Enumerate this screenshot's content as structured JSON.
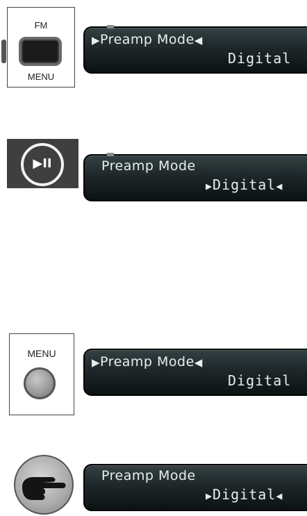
{
  "steps": [
    {
      "control": {
        "top_label": "FM",
        "bottom_label": "MENU"
      },
      "display": {
        "line1": "Preamp Mode",
        "line2": "Digital",
        "selected_line": 1
      }
    },
    {
      "control": {
        "icon": "play-pause-icon"
      },
      "display": {
        "line1": "Preamp Mode",
        "line2": "Digital",
        "selected_line": 2
      }
    },
    {
      "control": {
        "label": "MENU"
      },
      "display": {
        "line1": "Preamp Mode",
        "line2": "Digital",
        "selected_line": 1
      }
    },
    {
      "control": {
        "icon": "hand-pointer-icon"
      },
      "display": {
        "line1": "Preamp Mode",
        "line2": "Digital",
        "selected_line": 2
      }
    }
  ],
  "colors": {
    "lcd_background": "#1e2729",
    "lcd_text": "#e8eeee",
    "button_dark": "#1a1a1a",
    "panel_border": "#444444"
  }
}
